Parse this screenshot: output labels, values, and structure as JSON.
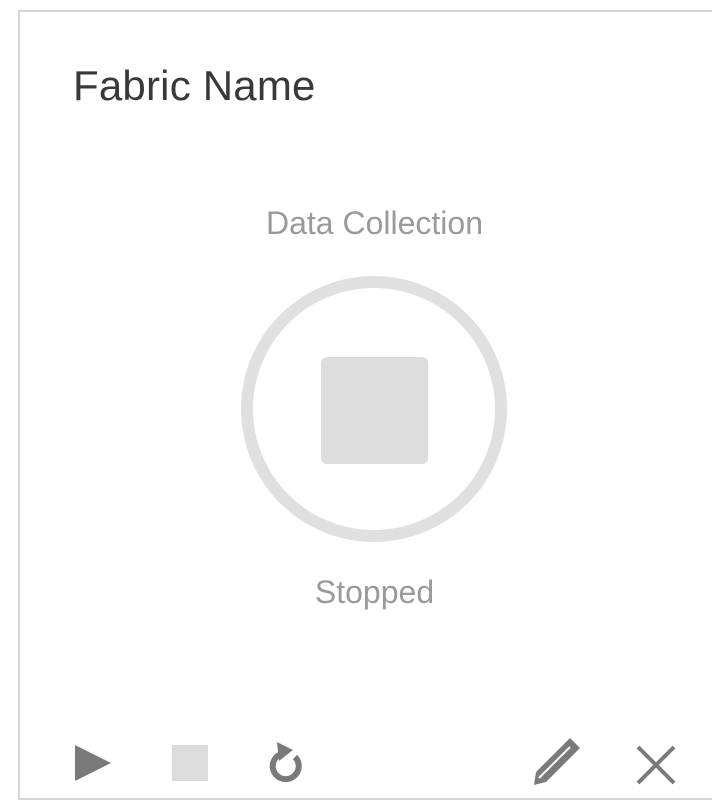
{
  "card": {
    "title": "Fabric Name",
    "section_label": "Data Collection",
    "status": "Stopped"
  },
  "actions": [
    {
      "name": "play-button",
      "icon": "play-icon"
    },
    {
      "name": "stop-button",
      "icon": "stop-icon"
    },
    {
      "name": "restart-button",
      "icon": "refresh-icon"
    },
    {
      "name": "edit-button",
      "icon": "pencil-icon"
    },
    {
      "name": "delete-button",
      "icon": "close-icon"
    }
  ],
  "colors": {
    "border": "#d6d6d6",
    "title": "#39393b",
    "muted_text": "#9a9a9a",
    "status_graphic": "#dddddd",
    "action_icon": "#7a7a7a",
    "action_icon_disabled": "#dcdcdc"
  }
}
